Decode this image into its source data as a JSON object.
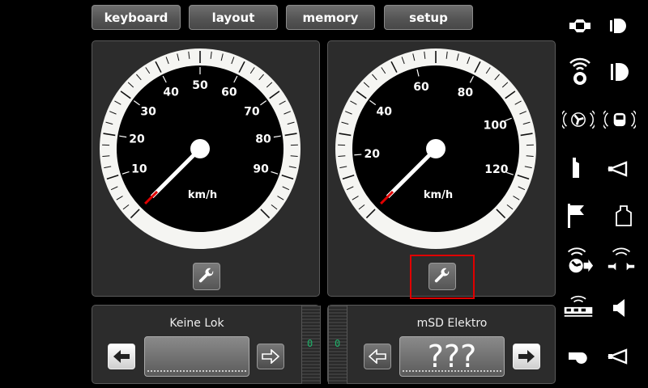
{
  "tabs": [
    {
      "label": "keyboard"
    },
    {
      "label": "layout"
    },
    {
      "label": "memory"
    },
    {
      "label": "setup"
    }
  ],
  "gauges": [
    {
      "unit": "km/h",
      "max": 100,
      "ticks": [
        10,
        20,
        30,
        40,
        50,
        60,
        70,
        80,
        90
      ],
      "value": 0
    },
    {
      "unit": "km/h",
      "max": 133,
      "ticks": [
        20,
        40,
        60,
        80,
        100,
        120
      ],
      "value": 0
    }
  ],
  "locos": [
    {
      "name": "Keine Lok",
      "display": "",
      "speed_readout": "0"
    },
    {
      "name": "mSD Elektro",
      "display": "???",
      "speed_readout": "0"
    }
  ],
  "function_icons": [
    "coupler-icon",
    "headlight-icon",
    "sound-bell-icon",
    "cab-light-icon",
    "fan-sound-icon",
    "loco-sound-icon",
    "pantograph-icon",
    "horn-icon",
    "flag-icon",
    "weight-icon",
    "smoke-sound-icon",
    "coupling-sound-icon",
    "train-sound-icon",
    "loudspeaker-icon",
    "whistle-icon",
    "horn-high-icon"
  ]
}
